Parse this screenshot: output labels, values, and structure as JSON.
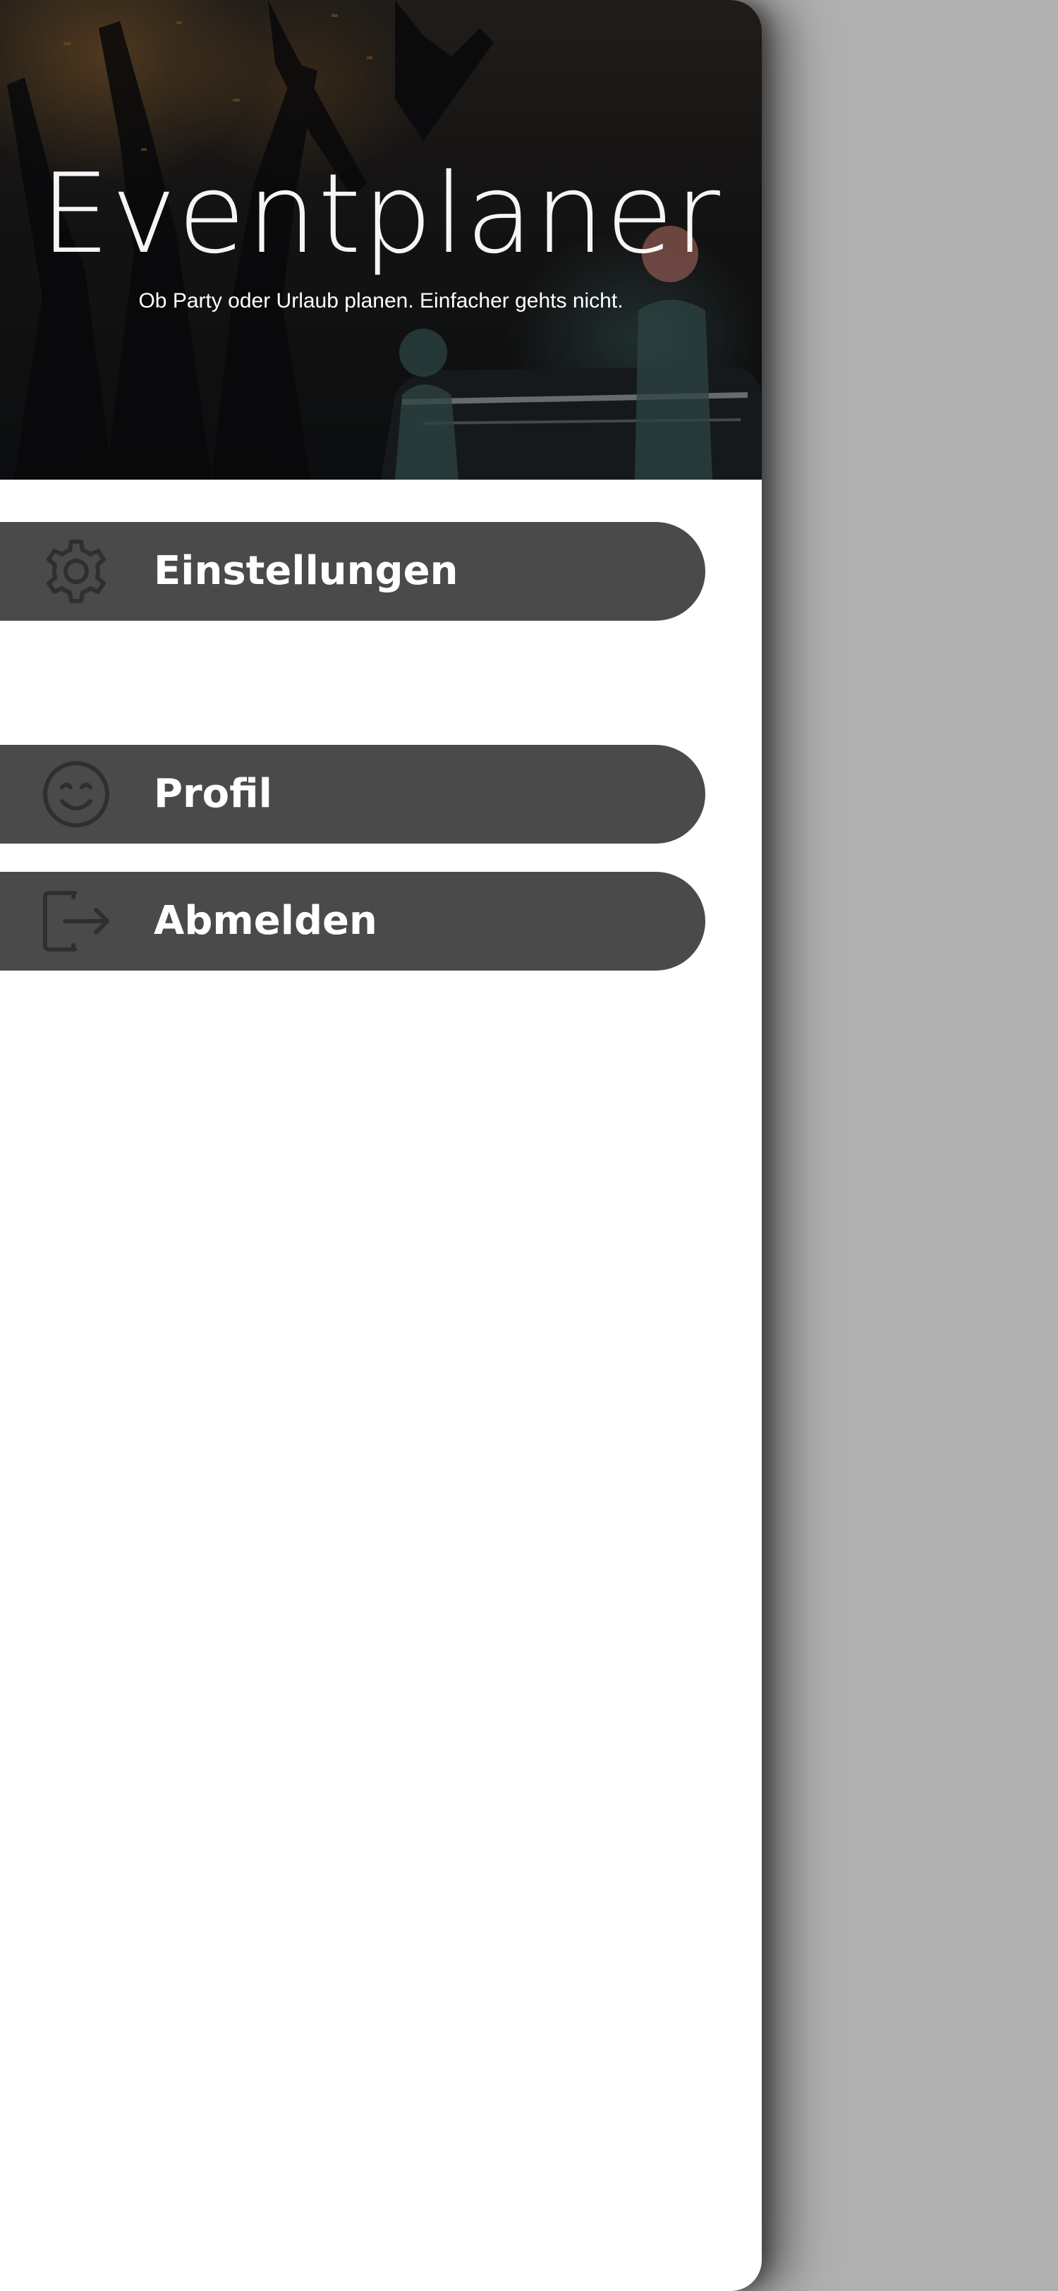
{
  "header": {
    "title": "Eventplaner",
    "subtitle": "Ob Party oder Urlaub planen. Einfacher gehts nicht."
  },
  "menu": {
    "items": [
      {
        "id": "settings",
        "label": "Einstellungen",
        "icon": "gear-icon"
      },
      {
        "id": "profile",
        "label": "Profil",
        "icon": "smiley-icon"
      },
      {
        "id": "logout",
        "label": "Abmelden",
        "icon": "logout-icon"
      }
    ]
  },
  "colors": {
    "menu_item_background": "#4a4a4a",
    "menu_icon": "#2f2f2f",
    "menu_text": "#ffffff",
    "drawer_background": "#ffffff",
    "scrim": "#b0b0b0"
  }
}
